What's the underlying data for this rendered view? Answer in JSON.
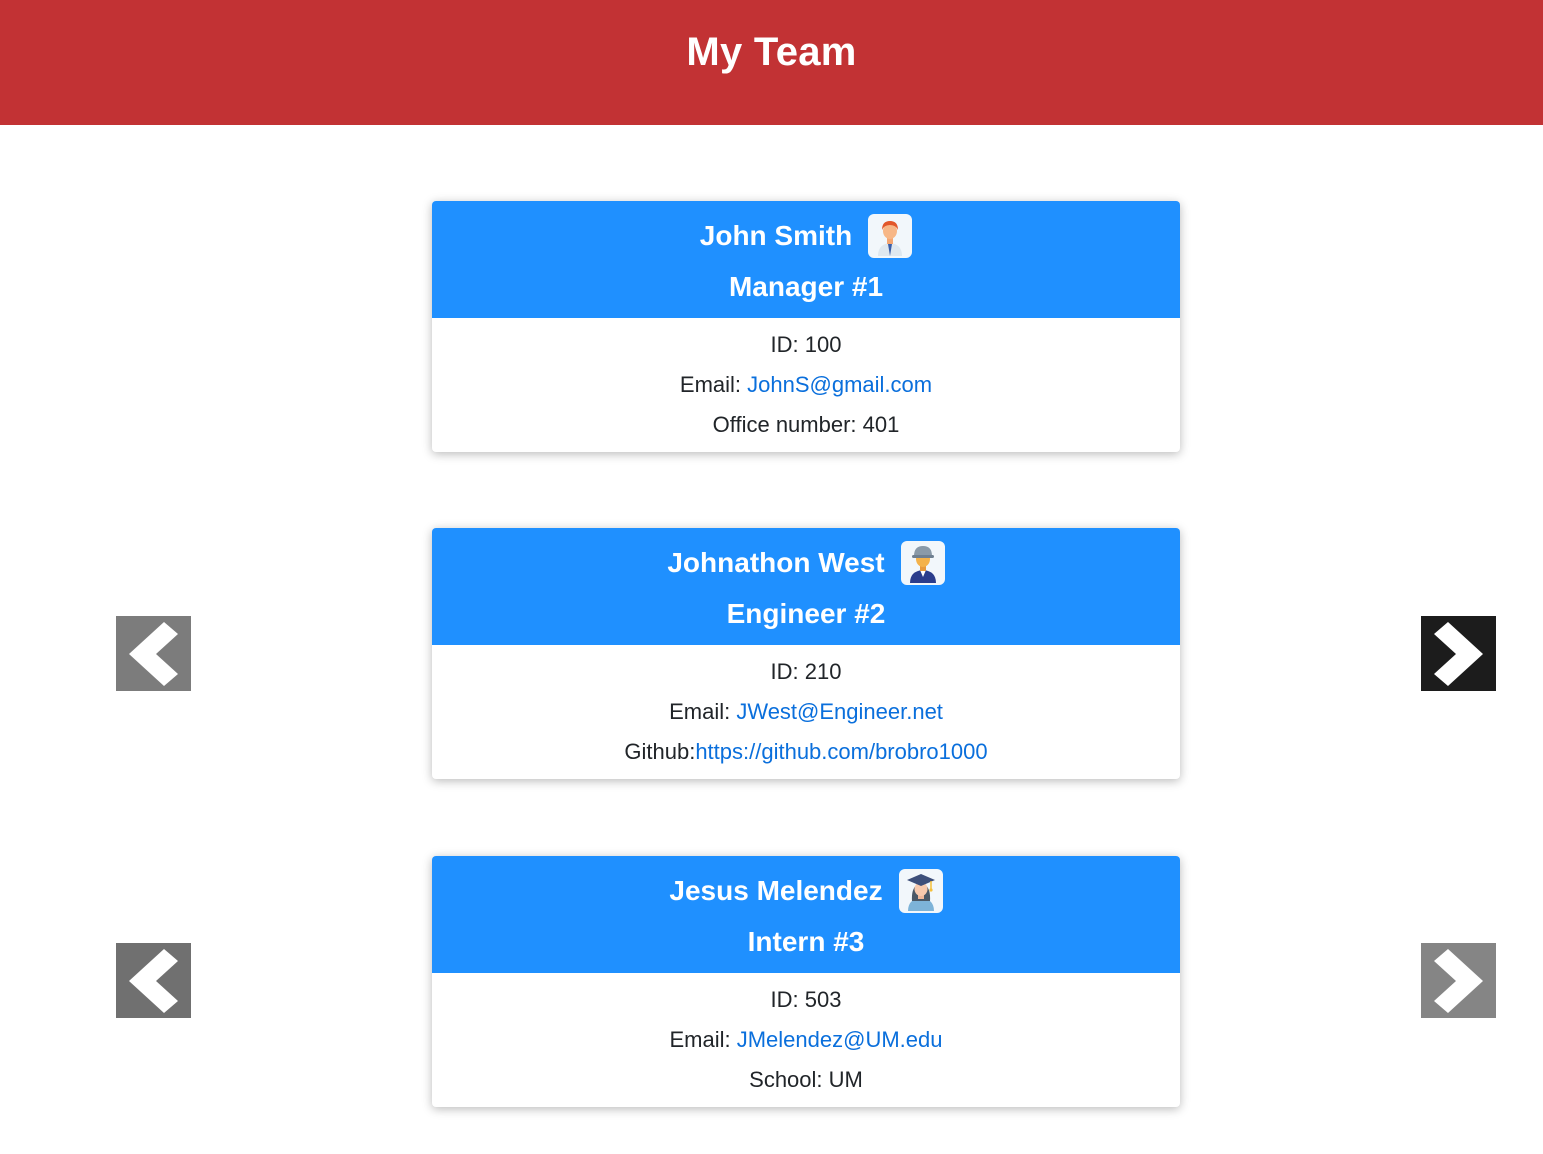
{
  "header": {
    "title": "My Team"
  },
  "colors": {
    "header_bg": "#c23234",
    "card_head_bg": "#1f90ff",
    "link": "#0a6fdc",
    "arrow_gray": "#7c7c7c",
    "arrow_dark": "#1c1c1c"
  },
  "cards": [
    {
      "name": "John Smith",
      "role": "Manager #1",
      "icon": "manager-avatar-icon",
      "id_label": "ID: 100",
      "email_label": "Email: ",
      "email": "JohnS@gmail.com",
      "extra_label": "Office number: 401",
      "extra_link": ""
    },
    {
      "name": "Johnathon West",
      "role": "Engineer #2",
      "icon": "engineer-avatar-icon",
      "id_label": "ID: 210",
      "email_label": "Email: ",
      "email": "JWest@Engineer.net",
      "extra_label": "Github:",
      "extra_link": "https://github.com/brobro1000"
    },
    {
      "name": "Jesus Melendez",
      "role": "Intern #3",
      "icon": "intern-avatar-icon",
      "id_label": "ID: 503",
      "email_label": "Email: ",
      "email": "JMelendez@UM.edu",
      "extra_label": "School: UM",
      "extra_link": ""
    }
  ],
  "nav": {
    "row2_prev": "chevron-left-icon",
    "row2_next": "chevron-right-icon",
    "row3_prev": "chevron-left-icon",
    "row3_next": "chevron-right-icon"
  }
}
